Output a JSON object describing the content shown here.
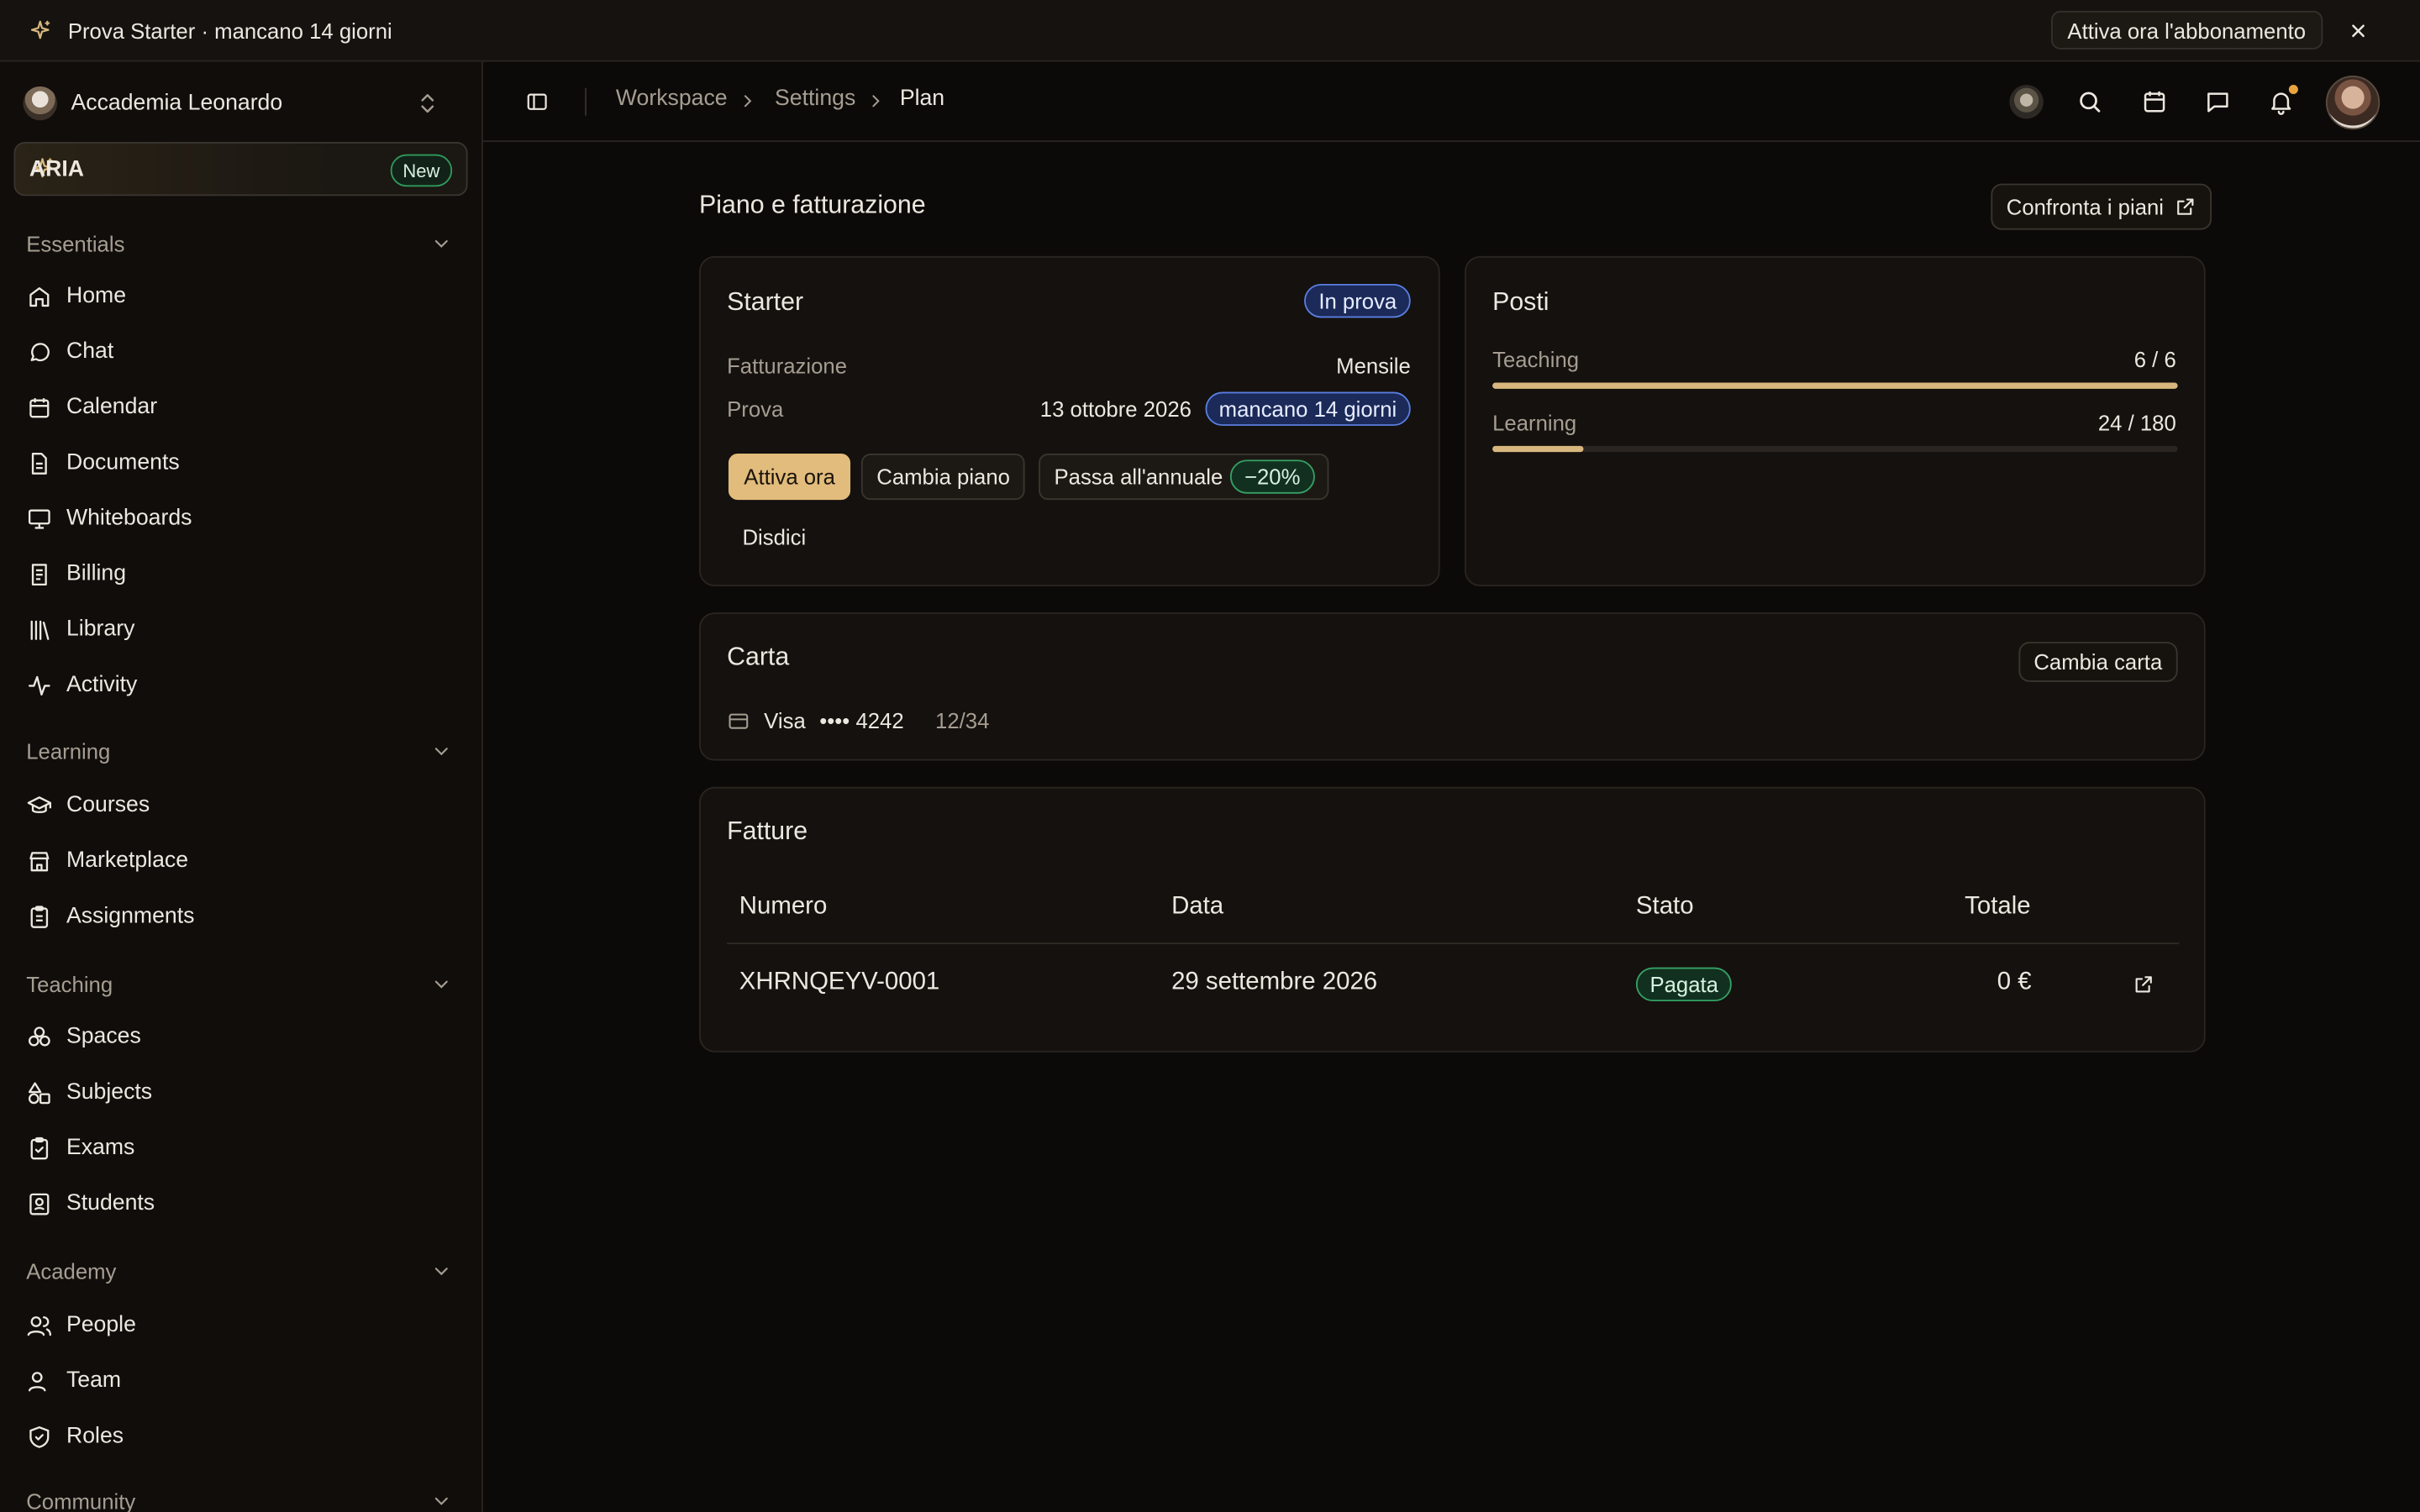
{
  "banner": {
    "text": "Prova Starter · mancano 14 giorni",
    "cta": "Attiva ora l'abbonamento",
    "close_icon": "close-icon"
  },
  "sidebar": {
    "workspace": "Accademia Leonardo",
    "aria": {
      "label": "ARIA",
      "badge": "New"
    },
    "sections": [
      {
        "title": "Essentials",
        "items": [
          {
            "label": "Home",
            "icon": "home-icon"
          },
          {
            "label": "Chat",
            "icon": "chat-icon"
          },
          {
            "label": "Calendar",
            "icon": "calendar-icon"
          },
          {
            "label": "Documents",
            "icon": "document-icon"
          },
          {
            "label": "Whiteboards",
            "icon": "whiteboard-icon"
          },
          {
            "label": "Billing",
            "icon": "billing-icon"
          },
          {
            "label": "Library",
            "icon": "library-icon"
          },
          {
            "label": "Activity",
            "icon": "activity-icon"
          }
        ]
      },
      {
        "title": "Learning",
        "items": [
          {
            "label": "Courses",
            "icon": "graduation-cap-icon"
          },
          {
            "label": "Marketplace",
            "icon": "store-icon"
          },
          {
            "label": "Assignments",
            "icon": "clipboard-icon"
          }
        ]
      },
      {
        "title": "Teaching",
        "items": [
          {
            "label": "Spaces",
            "icon": "spaces-icon"
          },
          {
            "label": "Subjects",
            "icon": "shapes-icon"
          },
          {
            "label": "Exams",
            "icon": "exam-icon"
          },
          {
            "label": "Students",
            "icon": "student-icon"
          }
        ]
      },
      {
        "title": "Academy",
        "items": [
          {
            "label": "People",
            "icon": "people-icon"
          },
          {
            "label": "Team",
            "icon": "team-icon"
          },
          {
            "label": "Roles",
            "icon": "shield-icon"
          }
        ]
      },
      {
        "title": "Community",
        "items": []
      }
    ]
  },
  "header": {
    "breadcrumb": [
      "Workspace",
      "Settings",
      "Plan"
    ]
  },
  "main": {
    "title": "Piano e fatturazione",
    "compare_button": "Confronta i piani",
    "plan": {
      "name": "Starter",
      "status": "In prova",
      "billing_label": "Fatturazione",
      "billing_value": "Mensile",
      "trial_label": "Prova",
      "trial_date": "13 ottobre 2026",
      "trial_remaining": "mancano 14 giorni",
      "activate": "Attiva ora",
      "change_plan": "Cambia piano",
      "annual": "Passa all'annuale",
      "annual_discount": "−20%",
      "cancel": "Disdici"
    },
    "seats": {
      "title": "Posti",
      "items": [
        {
          "label": "Teaching",
          "value": "6 / 6",
          "fraction": 1.0
        },
        {
          "label": "Learning",
          "value": "24 / 180",
          "fraction": 0.1333
        }
      ]
    },
    "card": {
      "title": "Carta",
      "change": "Cambia carta",
      "brand": "Visa",
      "number": "•••• 4242",
      "expiry": "12/34"
    },
    "invoices": {
      "title": "Fatture",
      "columns": [
        "Numero",
        "Data",
        "Stato",
        "Totale"
      ],
      "rows": [
        {
          "number": "XHRNQEYV-0001",
          "date": "29 settembre 2026",
          "status": "Pagata",
          "total": "0 €"
        }
      ]
    }
  }
}
